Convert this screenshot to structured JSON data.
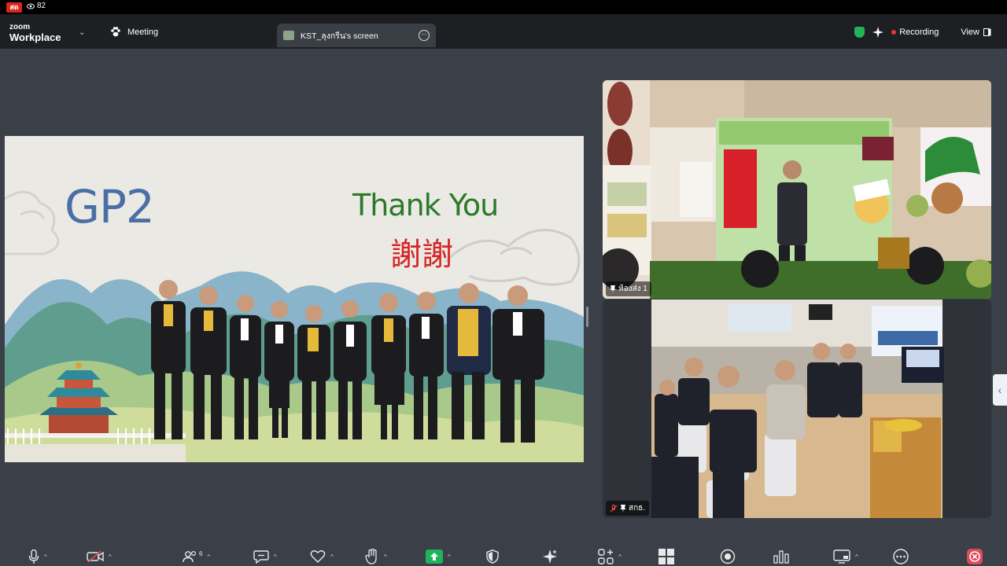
{
  "live": {
    "badge": "สด",
    "viewers": "82"
  },
  "app": {
    "brand_top": "zoom",
    "brand_bottom": "Workplace"
  },
  "menu": {
    "meeting_label": "Meeting"
  },
  "screen_tab": {
    "title": "KST_ลุงกรีน's screen"
  },
  "top_right": {
    "recording_label": "Recording",
    "view_label": "View"
  },
  "slide": {
    "heading": "GP2",
    "thank_you": "Thank You",
    "chinese_thanks": "謝謝"
  },
  "videos": [
    {
      "name": "ห้องส่ง 1",
      "muted": false
    },
    {
      "name": "สกธ.",
      "muted": true
    }
  ],
  "toolbar": {
    "participants_count": "6"
  },
  "colors": {
    "accent_green": "#1fb35b",
    "recording_red": "#e03b3b",
    "share_green": "#1fb35b",
    "leave_red": "#e04a5a"
  }
}
